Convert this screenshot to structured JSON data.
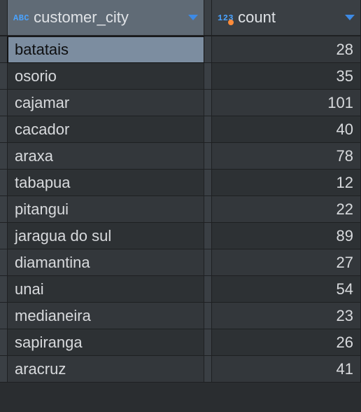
{
  "columns": [
    {
      "name": "customer_city",
      "type_label": "ABC",
      "type": "text",
      "align": "text",
      "selected": true
    },
    {
      "name": "count",
      "type_label": "123",
      "type": "int",
      "align": "num",
      "selected": false
    }
  ],
  "rows": [
    {
      "customer_city": "batatais",
      "count": 28,
      "selected_col": 0
    },
    {
      "customer_city": "osorio",
      "count": 35
    },
    {
      "customer_city": "cajamar",
      "count": 101
    },
    {
      "customer_city": "cacador",
      "count": 40
    },
    {
      "customer_city": "araxa",
      "count": 78
    },
    {
      "customer_city": "tabapua",
      "count": 12
    },
    {
      "customer_city": "pitangui",
      "count": 22
    },
    {
      "customer_city": "jaragua do sul",
      "count": 89
    },
    {
      "customer_city": "diamantina",
      "count": 27
    },
    {
      "customer_city": "unai",
      "count": 54
    },
    {
      "customer_city": "medianeira",
      "count": 23
    },
    {
      "customer_city": "sapiranga",
      "count": 26
    },
    {
      "customer_city": "aracruz",
      "count": 41
    }
  ]
}
